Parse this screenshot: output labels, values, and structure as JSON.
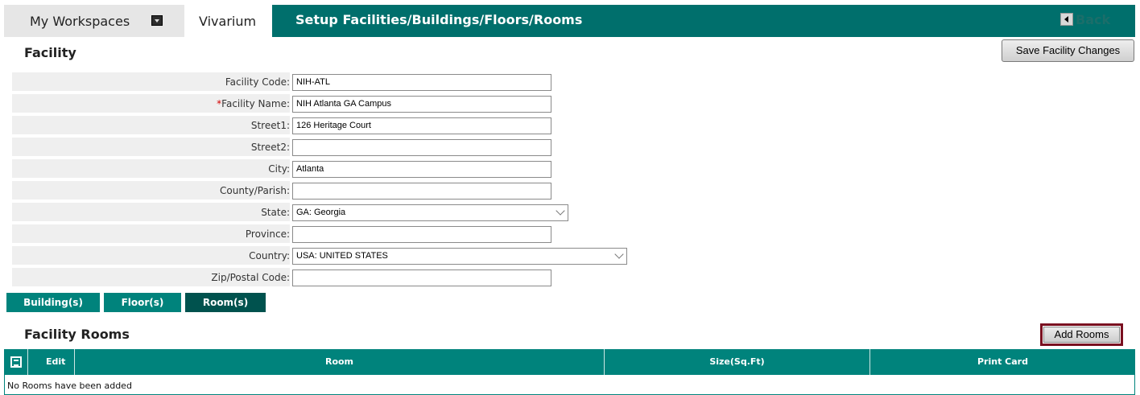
{
  "header": {
    "workspace_tab": "My Workspaces",
    "active_tab": "Vivarium",
    "title": "Setup Facilities/Buildings/Floors/Rooms",
    "back_label": "Back"
  },
  "facility": {
    "section_title": "Facility",
    "save_label": "Save Facility Changes",
    "fields": [
      {
        "label": "Facility Code:",
        "value": "NIH-ATL",
        "required": false
      },
      {
        "label": "Facility Name:",
        "value": "NIH Atlanta GA Campus",
        "required": true
      },
      {
        "label": "Street1:",
        "value": "126 Heritage Court",
        "required": false
      },
      {
        "label": "Street2:",
        "value": "",
        "required": false
      },
      {
        "label": "City:",
        "value": "Atlanta",
        "required": false
      },
      {
        "label": "County/Parish:",
        "value": "",
        "required": false
      },
      {
        "label": "State:",
        "value": "GA: Georgia",
        "required": false,
        "type": "select"
      },
      {
        "label": "Province:",
        "value": "",
        "required": false
      },
      {
        "label": "Country:",
        "value": "USA: UNITED STATES",
        "required": false,
        "type": "select"
      },
      {
        "label": "Zip/Postal Code:",
        "value": "",
        "required": false
      }
    ],
    "required_marker": "*"
  },
  "subtabs": [
    {
      "label": "Building(s)",
      "active": false
    },
    {
      "label": "Floor(s)",
      "active": false
    },
    {
      "label": "Room(s)",
      "active": true
    }
  ],
  "rooms": {
    "section_title": "Facility Rooms",
    "add_label": "Add Rooms",
    "columns": [
      "Edit",
      "Room",
      "Size(Sq.Ft)",
      "Print Card"
    ],
    "empty_message": "No Rooms have been added"
  },
  "icons": {
    "workspace_dropdown": "chevron-down-icon",
    "back": "back-arrow-icon",
    "table_settings": "table-settings-icon"
  },
  "colors": {
    "brand_teal": "#006f6c",
    "tab_teal": "#00837c",
    "active_tab": "#00524e",
    "required": "#d40000"
  }
}
